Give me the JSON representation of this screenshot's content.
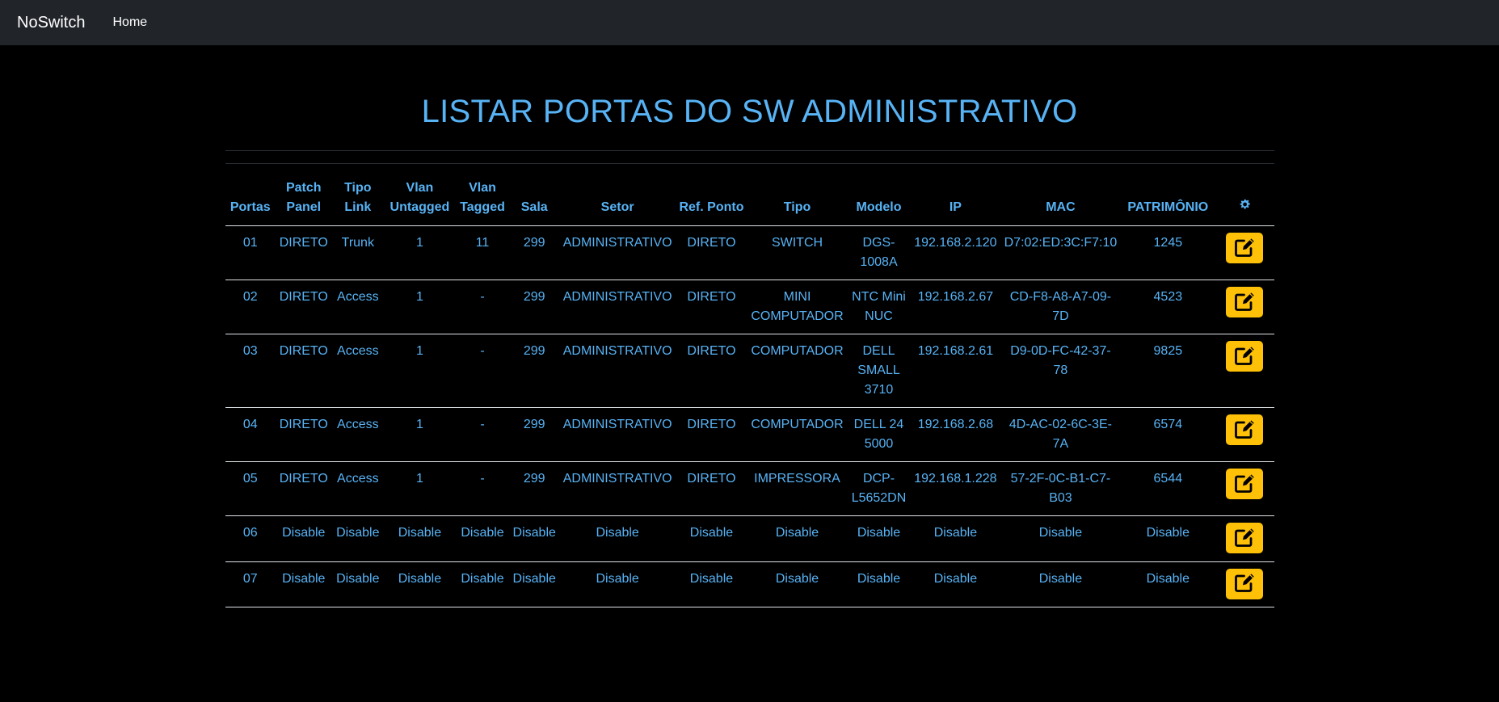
{
  "navbar": {
    "brand": "NoSwitch",
    "home": "Home"
  },
  "page": {
    "title": "LISTAR PORTAS DO SW ADMINISTRATIVO"
  },
  "table": {
    "headers": [
      "Portas",
      "Patch Panel",
      "Tipo Link",
      "Vlan Untagged",
      "Vlan Tagged",
      "Sala",
      "Setor",
      "Ref. Ponto",
      "Tipo",
      "Modelo",
      "IP",
      "MAC",
      "PATRIMÔNIO"
    ],
    "settings_icon": "gear-icon",
    "action_icon": "edit-icon",
    "rows": [
      [
        "01",
        "DIRETO",
        "Trunk",
        "1",
        "11",
        "299",
        "ADMINISTRATIVO",
        "DIRETO",
        "SWITCH",
        "DGS-1008A",
        "192.168.2.120",
        "D7:02:ED:3C:F7:10",
        "1245"
      ],
      [
        "02",
        "DIRETO",
        "Access",
        "1",
        "-",
        "299",
        "ADMINISTRATIVO",
        "DIRETO",
        "MINI COMPUTADOR",
        "NTC Mini NUC",
        "192.168.2.67",
        "CD-F8-A8-A7-09-7D",
        "4523"
      ],
      [
        "03",
        "DIRETO",
        "Access",
        "1",
        "-",
        "299",
        "ADMINISTRATIVO",
        "DIRETO",
        "COMPUTADOR",
        "DELL SMALL 3710",
        "192.168.2.61",
        "D9-0D-FC-42-37-78",
        "9825"
      ],
      [
        "04",
        "DIRETO",
        "Access",
        "1",
        "-",
        "299",
        "ADMINISTRATIVO",
        "DIRETO",
        "COMPUTADOR",
        "DELL 24 5000",
        "192.168.2.68",
        "4D-AC-02-6C-3E-7A",
        "6574"
      ],
      [
        "05",
        "DIRETO",
        "Access",
        "1",
        "-",
        "299",
        "ADMINISTRATIVO",
        "DIRETO",
        "IMPRESSORA",
        "DCP-L5652DN",
        "192.168.1.228",
        "57-2F-0C-B1-C7-B03",
        "6544"
      ],
      [
        "06",
        "Disable",
        "Disable",
        "Disable",
        "Disable",
        "Disable",
        "Disable",
        "Disable",
        "Disable",
        "Disable",
        "Disable",
        "Disable",
        "Disable"
      ],
      [
        "07",
        "Disable",
        "Disable",
        "Disable",
        "Disable",
        "Disable",
        "Disable",
        "Disable",
        "Disable",
        "Disable",
        "Disable",
        "Disable",
        "Disable"
      ]
    ]
  },
  "colors": {
    "accent": "#58b3f5",
    "navbar": "#212529",
    "edit_button": "#ffc107",
    "background": "#000000"
  }
}
